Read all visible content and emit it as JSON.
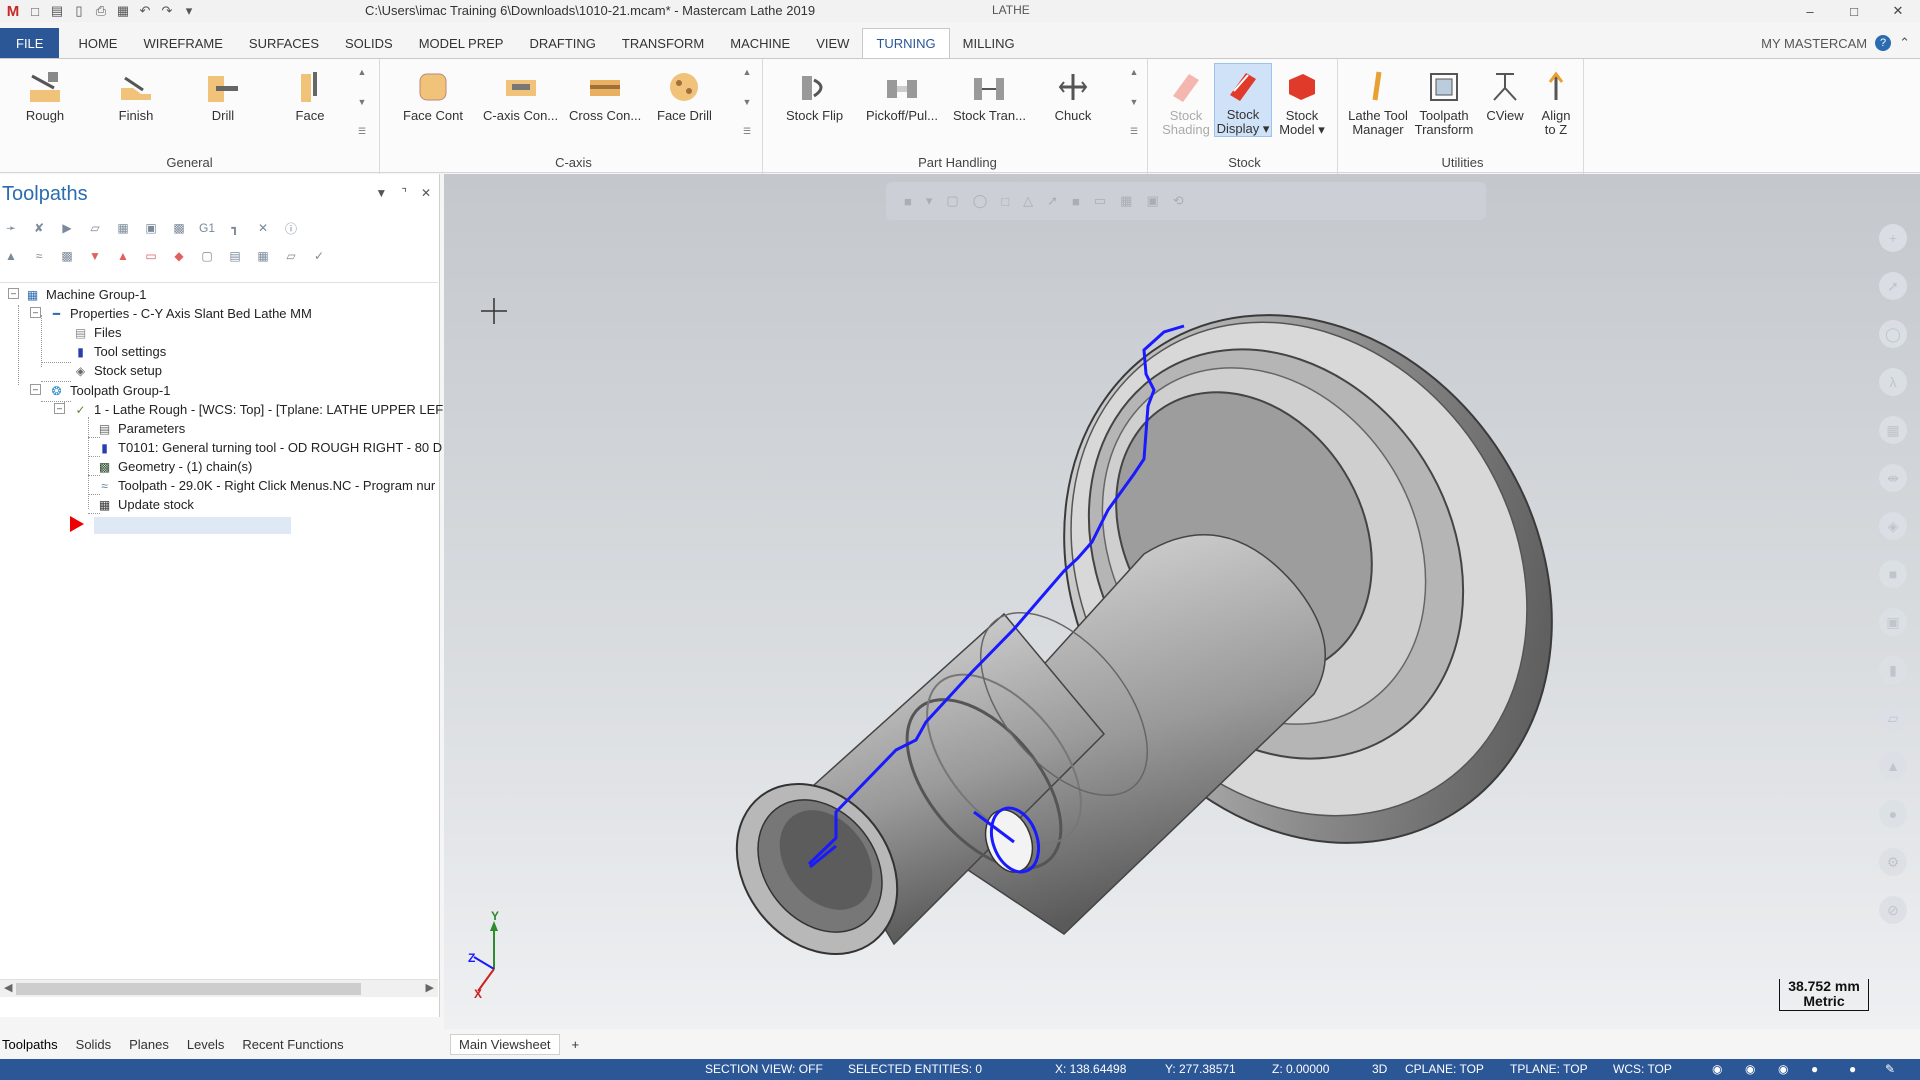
{
  "window": {
    "title": "C:\\Users\\imac Training 6\\Downloads\\1010-21.mcam* - Mastercam Lathe 2019",
    "context_tag": "LATHE"
  },
  "ribbon_tabs": [
    "FILE",
    "HOME",
    "WIREFRAME",
    "SURFACES",
    "SOLIDS",
    "MODEL PREP",
    "DRAFTING",
    "TRANSFORM",
    "MACHINE",
    "VIEW",
    "TURNING",
    "MILLING"
  ],
  "active_tab": "TURNING",
  "my_mastercam": "MY MASTERCAM",
  "ribbon": {
    "general": {
      "label": "General",
      "rough": "Rough",
      "finish": "Finish",
      "drill": "Drill",
      "face": "Face"
    },
    "caxis": {
      "label": "C-axis",
      "face_cont": "Face Cont",
      "caxis_con": "C-axis Con...",
      "cross_con": "Cross Con...",
      "face_drill": "Face Drill"
    },
    "part_handling": {
      "label": "Part Handling",
      "stock_flip": "Stock Flip",
      "pickoff": "Pickoff/Pul...",
      "stock_tran": "Stock Tran...",
      "chuck": "Chuck"
    },
    "stock": {
      "label": "Stock",
      "stock_shading_1": "Stock",
      "stock_shading_2": "Shading",
      "stock_display_1": "Stock",
      "stock_display_2": "Display",
      "stock_model_1": "Stock",
      "stock_model_2": "Model"
    },
    "utilities": {
      "label": "Utilities",
      "lathe_tool_1": "Lathe Tool",
      "lathe_tool_2": "Manager",
      "toolpath_transform_1": "Toolpath",
      "toolpath_transform_2": "Transform",
      "cview": "CView",
      "align_1": "Align",
      "align_2": "to Z"
    }
  },
  "panel": {
    "title": "Toolpaths",
    "tree": {
      "machine_group": "Machine Group-1",
      "properties": "Properties - C-Y Axis Slant Bed Lathe MM",
      "files": "Files",
      "tool_settings": "Tool settings",
      "stock_setup": "Stock setup",
      "toolpath_group": "Toolpath Group-1",
      "op1": "1 - Lathe Rough - [WCS: Top] - [Tplane: LATHE UPPER LEF",
      "parameters": "Parameters",
      "tool": "T0101: General turning tool - OD ROUGH RIGHT - 80 D",
      "geometry": "Geometry - (1) chain(s)",
      "toolpath": "Toolpath - 29.0K - Right Click Menus.NC - Program nur",
      "update_stock": "Update stock"
    }
  },
  "bottom_tabs": [
    "Toolpaths",
    "Solids",
    "Planes",
    "Levels",
    "Recent Functions"
  ],
  "viewsheet": {
    "main": "Main Viewsheet",
    "add": "+"
  },
  "viewport": {
    "scale_value": "38.752 mm",
    "scale_unit": "Metric",
    "axis_x": "X",
    "axis_y": "Y",
    "axis_z": "Z"
  },
  "status": {
    "section_view": "SECTION VIEW: OFF",
    "selected": "SELECTED ENTITIES: 0",
    "x": "X:  138.64498",
    "y": "Y:  277.38571",
    "z": "Z:  0.00000",
    "mode": "3D",
    "cplane": "CPLANE: TOP",
    "tplane": "TPLANE: TOP",
    "wcs": "WCS: TOP"
  },
  "colors": {
    "accent": "#2b5797",
    "toolpath": "#1a1aff",
    "title_blue": "#2b6cb0"
  }
}
